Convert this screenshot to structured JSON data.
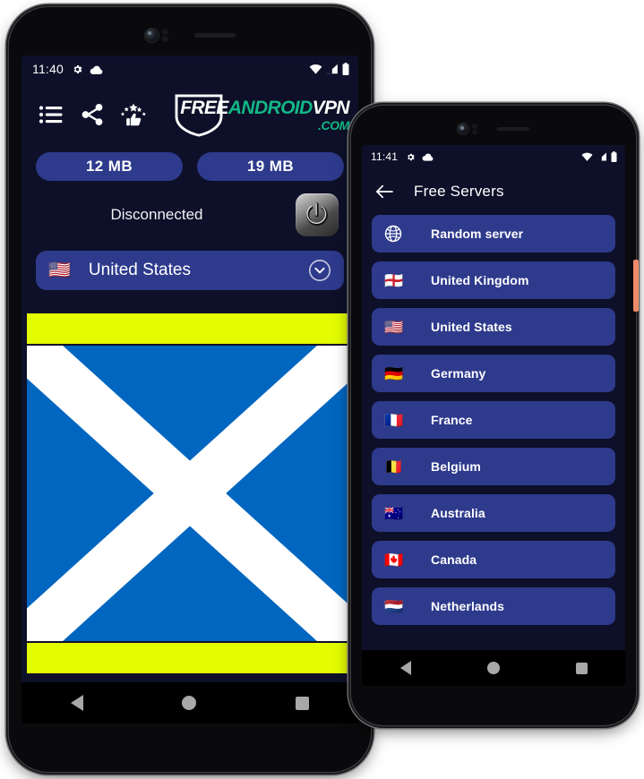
{
  "phone_main": {
    "status_bar": {
      "time": "11:40",
      "left_icons": [
        "gear-icon",
        "cloud-icon"
      ],
      "right_icons": [
        "wifi-icon",
        "signal-icon",
        "battery-icon"
      ]
    },
    "toolbar": {
      "icons": [
        "menu-list-icon",
        "share-icon",
        "rate-us-icon"
      ],
      "brand": {
        "part_free": "FREE",
        "part_android": "ANDROID",
        "part_vpn": "VPN",
        "part_com": ".COM",
        "color_white": "#ffffff",
        "color_teal": "#12b886"
      }
    },
    "stats": {
      "download": "12 MB",
      "upload": "19 MB"
    },
    "connection": {
      "status_text": "Disconnected",
      "power_button_label": "power-toggle"
    },
    "country_selector": {
      "flag": "🇺🇸",
      "label": "United States",
      "chevron": "chevron-down-circle-icon"
    },
    "ad_banner": {
      "top_bar_color": "#e3fc00",
      "flag_bg_color": "#0066c0",
      "flag_cross_color": "#ffffff",
      "bottom_bar_color": "#e3fc00"
    },
    "nav_bar": {
      "back": "back-triangle",
      "home": "home-circle",
      "recents": "recents-square"
    }
  },
  "phone_servers": {
    "status_bar": {
      "time": "11:41",
      "left_icons": [
        "gear-icon",
        "cloud-icon"
      ],
      "right_icons": [
        "wifi-icon",
        "signal-icon",
        "battery-icon"
      ]
    },
    "header": {
      "back_icon": "arrow-left-icon",
      "title": "Free Servers"
    },
    "servers": [
      {
        "flag": "globe",
        "name": "Random server"
      },
      {
        "flag": "🏴󠁧󠁢󠁥󠁮󠁧󠁿",
        "name": "United Kingdom"
      },
      {
        "flag": "🇺🇸",
        "name": "United States"
      },
      {
        "flag": "🇩🇪",
        "name": "Germany"
      },
      {
        "flag": "🇫🇷",
        "name": "France"
      },
      {
        "flag": "🇧🇪",
        "name": "Belgium"
      },
      {
        "flag": "🇦🇺",
        "name": "Australia"
      },
      {
        "flag": "🇨🇦",
        "name": "Canada"
      },
      {
        "flag": "🇳🇱",
        "name": "Netherlands"
      }
    ],
    "nav_bar": {
      "back": "back-triangle",
      "home": "home-circle",
      "recents": "recents-square"
    },
    "side_button_color": "#f08a6a"
  },
  "theme": {
    "screen_bg": "#0d1028",
    "card_bg": "#2e3a8c",
    "accent_teal": "#12b886",
    "text_primary": "#ffffff"
  }
}
